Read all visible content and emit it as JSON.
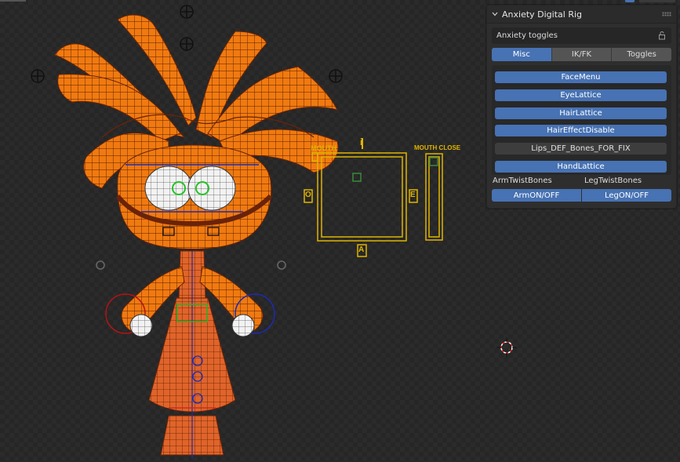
{
  "panel": {
    "title": "Anxiety Digital Rig",
    "subheader": "Anxiety toggles",
    "tabs": [
      {
        "label": "Misc",
        "active": true
      },
      {
        "label": "IK/FK",
        "active": false
      },
      {
        "label": "Toggles",
        "active": false
      }
    ],
    "buttons": [
      {
        "label": "FaceMenu",
        "state": "on"
      },
      {
        "label": "EyeLattice",
        "state": "on"
      },
      {
        "label": "HairLattice",
        "state": "on"
      },
      {
        "label": "HairEffectDisable",
        "state": "on"
      },
      {
        "label": "Lips_DEF_Bones_FOR_FIX",
        "state": "off"
      },
      {
        "label": "HandLattice",
        "state": "on"
      }
    ],
    "arm_twist_label": "ArmTwistBones",
    "leg_twist_label": "LegTwistBones",
    "arm_toggle_label": "ArmON/OFF",
    "leg_toggle_label": "LegON/OFF"
  },
  "viewport": {
    "rig_labels": {
      "mouth": "MOUTH",
      "mouth_close": "MOUTH CLOSE",
      "i": "i",
      "o": "O",
      "e": "E",
      "a": "A"
    }
  },
  "colors": {
    "accent": "#4772b3",
    "rig_yellow": "#e0b400",
    "mesh_orange": "#f07a10"
  }
}
